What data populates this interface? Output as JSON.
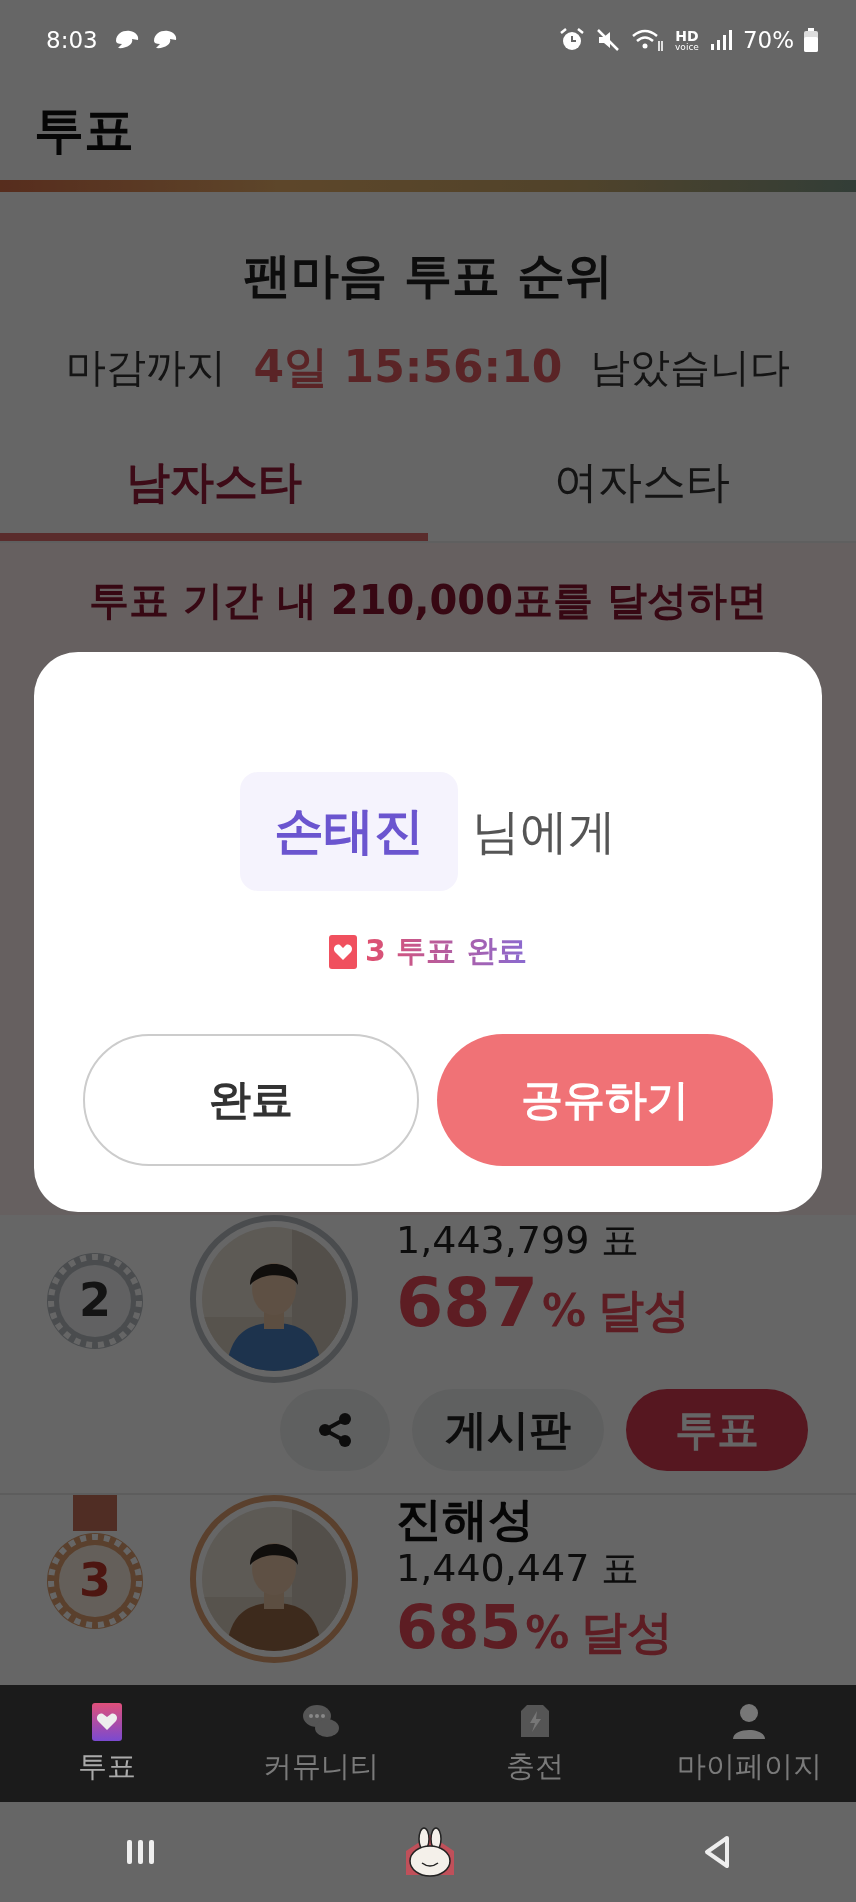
{
  "status_bar": {
    "time": "8:03",
    "hd_voice": [
      "HD",
      "voice"
    ],
    "battery": "70%"
  },
  "header": {
    "title": "투표"
  },
  "ranking": {
    "title": "팬마음 투표 순위",
    "countdown": {
      "prefix": "마감까지",
      "remaining": "4일 15:56:10",
      "suffix": "남았습니다"
    }
  },
  "tabs": [
    {
      "label": "남자스타",
      "selected": true
    },
    {
      "label": "여자스타",
      "selected": false
    }
  ],
  "goal_banner": "투표 기간 내 210,000표를 달성하면",
  "entries": [
    {
      "rank": "2",
      "votes": "1,443,799 표",
      "percent": "687",
      "percent_unit": "%",
      "achieved": "달성",
      "actions": {
        "board": "게시판",
        "vote": "투표"
      }
    },
    {
      "rank": "3",
      "name": "진해성",
      "votes": "1,440,447 표",
      "percent": "685",
      "percent_unit": "%",
      "achieved": "달성"
    }
  ],
  "dialog": {
    "recipient": "손태진",
    "recipient_suffix": "님에게",
    "result": "3 투표 완료",
    "buttons": [
      {
        "label": "완료",
        "kind": "secondary"
      },
      {
        "label": "공유하기",
        "kind": "primary"
      }
    ]
  },
  "bottom_nav": [
    {
      "label": "투표",
      "selected": true
    },
    {
      "label": "커뮤니티",
      "selected": false
    },
    {
      "label": "충전",
      "selected": false
    },
    {
      "label": "마이페이지",
      "selected": false
    }
  ]
}
